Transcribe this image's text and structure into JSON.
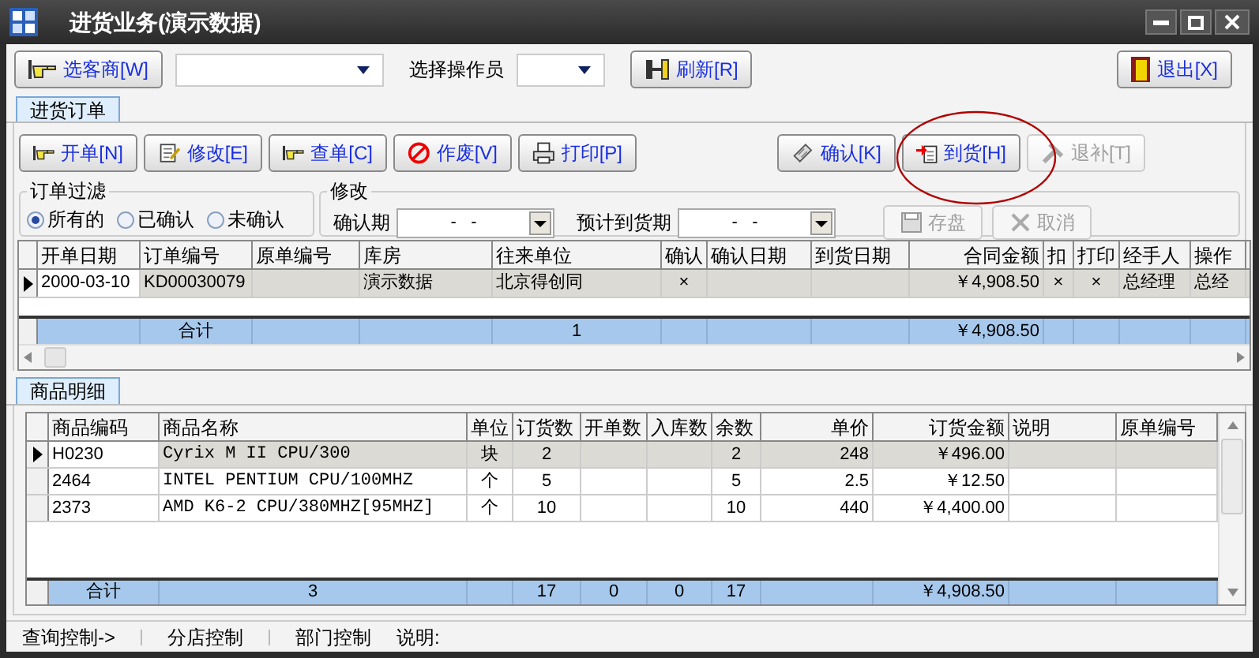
{
  "window": {
    "title": "进货业务(演示数据)"
  },
  "toolbar": {
    "supplier_button": "选客商[W]",
    "operator_label": "选择操作员",
    "refresh_button": "刷新[R]",
    "exit_button": "退出[X]"
  },
  "order_tab": {
    "label": "进货订单",
    "selected": true
  },
  "actions": [
    {
      "label": "开单[N]",
      "disabled": false
    },
    {
      "label": "修改[E]",
      "disabled": false
    },
    {
      "label": "查单[C]",
      "disabled": false
    },
    {
      "label": "作废[V]",
      "disabled": false
    },
    {
      "label": "打印[P]",
      "disabled": false
    },
    {
      "label": "确认[K]",
      "disabled": false
    },
    {
      "label": "到货[H]",
      "disabled": false,
      "highlighted": true
    },
    {
      "label": "退补[T]",
      "disabled": true
    }
  ],
  "filter": {
    "title": "订单过滤",
    "options": [
      {
        "label": "所有的",
        "selected": true
      },
      {
        "label": "已确认",
        "selected": false
      },
      {
        "label": "未确认",
        "selected": false
      }
    ]
  },
  "modify": {
    "title": "修改",
    "confirm_label": "确认期",
    "confirm_value": "-   -",
    "expected_label": "预计到货期",
    "expected_value": "-   -",
    "save_button": {
      "label": "存盘",
      "disabled": true
    },
    "cancel_button": {
      "label": "取消",
      "disabled": true
    }
  },
  "orders": {
    "columns": [
      "开单日期",
      "订单编号",
      "原单编号",
      "库房",
      "往来单位",
      "确认",
      "确认日期",
      "到货日期",
      "合同金额",
      "扣",
      "打印",
      "经手人",
      "操作"
    ],
    "rows": [
      {
        "selected": true,
        "open_date": "2000-03-10",
        "order_no": "KD00030079",
        "warehouse": "演示数据",
        "partner": "北京得创同",
        "confirmed": "×",
        "contract_amount": "￥4,908.50",
        "deduct": "×",
        "printed": "×",
        "handler": "总经理",
        "operator": "总经"
      }
    ],
    "total": {
      "order_no": "合计",
      "partner": "1",
      "contract_amount": "￥4,908.50"
    }
  },
  "detail_tab": {
    "label": "商品明细",
    "selected": true
  },
  "items": {
    "columns": [
      "商品编码",
      "商品名称",
      "单位",
      "订货数",
      "开单数",
      "入库数",
      "余数",
      "单价",
      "订货金额",
      "说明",
      "原单编号"
    ],
    "rows": [
      {
        "selected": true,
        "code": "H0230",
        "name": "Cyrix M II CPU/300",
        "unit": "块",
        "ordered": "2",
        "remaining": "2",
        "unit_price": "248",
        "order_amount": "￥496.00"
      },
      {
        "selected": false,
        "code": "2464",
        "name": "INTEL PENTIUM CPU/100MHZ",
        "unit": "个",
        "ordered": "5",
        "remaining": "5",
        "unit_price": "2.5",
        "order_amount": "￥12.50"
      },
      {
        "selected": false,
        "code": "2373",
        "name": "AMD K6-2 CPU/380MHZ[95MHZ]",
        "unit": "个",
        "ordered": "10",
        "remaining": "10",
        "unit_price": "440",
        "order_amount": "￥4,400.00"
      }
    ],
    "total": {
      "code": "合计",
      "name": "3",
      "ordered": "17",
      "billed": "0",
      "stocked": "0",
      "remaining": "17",
      "order_amount": "￥4,908.50"
    }
  },
  "status_bar": [
    "查询控制->",
    "分店控制",
    "部门控制",
    "说明:"
  ]
}
